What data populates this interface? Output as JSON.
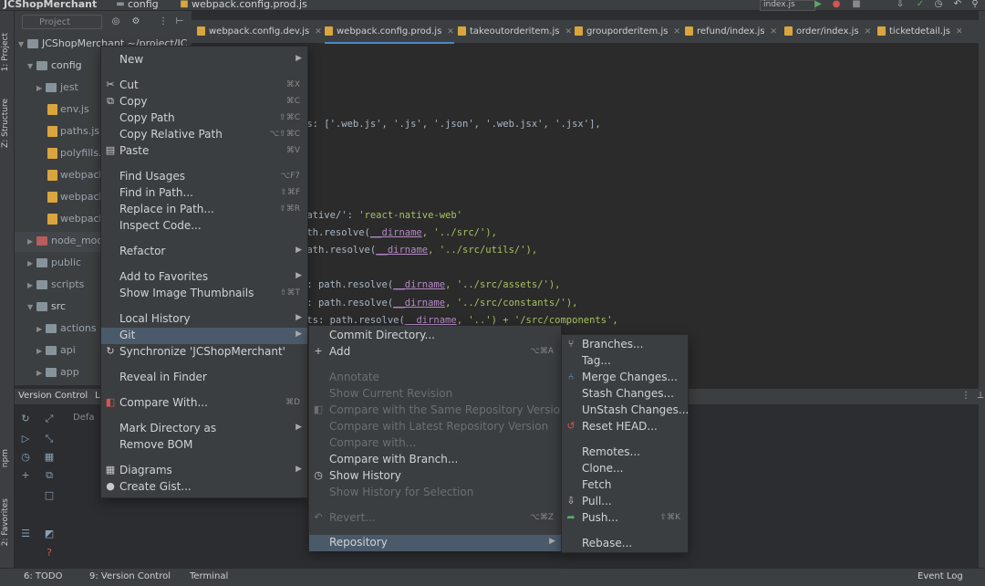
{
  "top": {
    "project": "JCShopMerchant",
    "crumb1": "config",
    "crumb2": "webpack.config.prod.js",
    "run_config": "index.js"
  },
  "left_stripe": {
    "project_label": "1: Project",
    "structure_label": "Z: Structure",
    "npm_label": "npm",
    "favorites_label": "2: Favorites"
  },
  "project_panel": {
    "view_selector": "Project",
    "root": "JCShopMerchant ~/project/JC",
    "rows": [
      "config",
      "jest",
      "env.js",
      "paths.js",
      "polyfills.js",
      "webpack",
      "webpack",
      "webpack",
      "node_modules",
      "public",
      "scripts",
      "src",
      "actions",
      "api",
      "app"
    ]
  },
  "tabs": [
    {
      "label": "webpack.config.dev.js"
    },
    {
      "label": "webpack.config.prod.js"
    },
    {
      "label": "takeoutorderitem.js"
    },
    {
      "label": "grouporderitem.js"
    },
    {
      "label": "refund/index.js"
    },
    {
      "label": "order/index.js"
    },
    {
      "label": "ticketdetail.js"
    }
  ],
  "code": {
    "line1": "ns: ['.web.js', '.js', '.json', '.web.jsx', '.jsx'],",
    "line2_key": "native/': ",
    "line2_val": "'react-native-web'",
    "line3_a": "ath.resolve(",
    "line3_dir": "__dirname",
    "line3_b": ", '../src/'),",
    "line4_a": "path.resolve(",
    "line4_dir": "__dirname",
    "line4_b": ", '../src/utils/'),",
    "line5_a": "s: path.resolve(",
    "line5_dir": "__dirname",
    "line5_b": ", '../src/assets/'),",
    "line6_a": "s: path.resolve(",
    "line6_dir": "__dirname",
    "line6_b": ", '../src/constants/'),",
    "line7_a": "nts: path.resolve(",
    "line7_dir": "__dirname",
    "line7_b": ", '..') + '/src/components',"
  },
  "context_menu": {
    "new": "New",
    "cut": "Cut",
    "cut_key": "⌘X",
    "copy": "Copy",
    "copy_key": "⌘C",
    "copy_path": "Copy Path",
    "copy_path_key": "⇧⌘C",
    "copy_rel_path": "Copy Relative Path",
    "copy_rel_path_key": "⌥⇧⌘C",
    "paste": "Paste",
    "paste_key": "⌘V",
    "find_usages": "Find Usages",
    "find_usages_key": "⌥F7",
    "find_in_path": "Find in Path...",
    "find_in_path_key": "⇧⌘F",
    "replace_in_path": "Replace in Path...",
    "replace_in_path_key": "⇧⌘R",
    "inspect_code": "Inspect Code...",
    "refactor": "Refactor",
    "add_favorites": "Add to Favorites",
    "show_thumbnails": "Show Image Thumbnails",
    "show_thumbnails_key": "⇧⌘T",
    "local_history": "Local History",
    "git": "Git",
    "synchronize": "Synchronize 'JCShopMerchant'",
    "reveal": "Reveal in Finder",
    "compare_with": "Compare With...",
    "compare_with_key": "⌘D",
    "mark_dir": "Mark Directory as",
    "remove_bom": "Remove BOM",
    "diagrams": "Diagrams",
    "create_gist": "Create Gist..."
  },
  "git_menu": {
    "commit_dir": "Commit Directory...",
    "add": "Add",
    "add_key": "⌥⌘A",
    "annotate": "Annotate",
    "show_current_rev": "Show Current Revision",
    "compare_same_repo": "Compare with the Same Repository Version",
    "compare_latest_repo": "Compare with Latest Repository Version",
    "compare_with": "Compare with...",
    "compare_branch": "Compare with Branch...",
    "show_history": "Show History",
    "show_history_sel": "Show History for Selection",
    "revert": "Revert...",
    "revert_key": "⌥⌘Z",
    "repository": "Repository"
  },
  "repo_menu": {
    "branches": "Branches...",
    "tag": "Tag...",
    "merge": "Merge Changes...",
    "stash": "Stash Changes...",
    "unstash": "UnStash Changes...",
    "reset_head": "Reset HEAD...",
    "remotes": "Remotes...",
    "clone": "Clone...",
    "fetch": "Fetch",
    "pull": "Pull...",
    "push": "Push...",
    "push_key": "⇧⌘K",
    "rebase": "Rebase..."
  },
  "vc_panel": {
    "tab": "Version Control",
    "tab2": "Lo",
    "default_label": "Defa"
  },
  "status": {
    "todo": "6: TODO",
    "vc": "9: Version Control",
    "terminal": "Terminal",
    "event_log": "Event Log"
  },
  "colors": {
    "accent": "#4a88c7",
    "selection": "#4b5a6a",
    "js_icon": "#d9a53f"
  }
}
